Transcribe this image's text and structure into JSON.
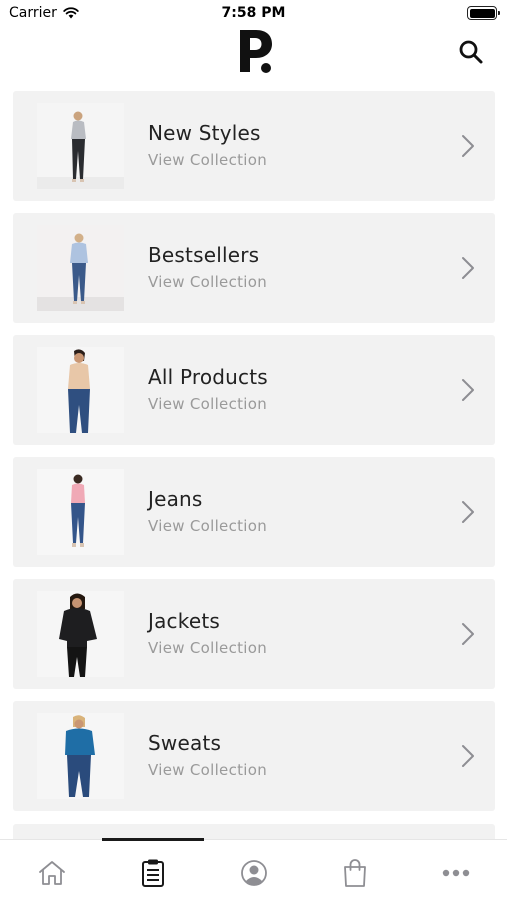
{
  "status_bar": {
    "carrier": "Carrier",
    "time": "7:58 PM"
  },
  "nav": {
    "logo_icon": "brand-p-logo",
    "search_icon": "search-icon"
  },
  "collections": [
    {
      "title": "New Styles",
      "subtitle": "View Collection",
      "image": "model-grey-top-black-jeans"
    },
    {
      "title": "Bestsellers",
      "subtitle": "View Collection",
      "image": "model-blue-blouse-jeans"
    },
    {
      "title": "All Products",
      "subtitle": "View Collection",
      "image": "model-beige-top-jeans"
    },
    {
      "title": "Jeans",
      "subtitle": "View Collection",
      "image": "model-pink-top-jeans"
    },
    {
      "title": "Jackets",
      "subtitle": "View Collection",
      "image": "model-black-jacket"
    },
    {
      "title": "Sweats",
      "subtitle": "View Collection",
      "image": "model-blue-sweater-jeans"
    }
  ],
  "tab_bar": {
    "active_tab": "collections",
    "tabs": [
      "home-icon",
      "clipboard-icon",
      "profile-icon",
      "shopping-bag-icon",
      "more-icon"
    ]
  },
  "colors": {
    "card_background": "#f2f2f2",
    "subtitle_gray": "#9a9a9a",
    "icon_gray": "#8e8e93",
    "active_dark": "#1a1a1a"
  }
}
